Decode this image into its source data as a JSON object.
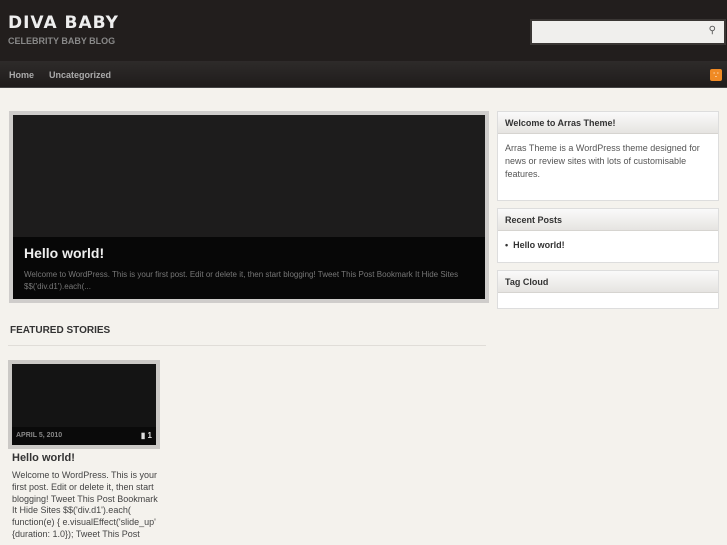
{
  "header": {
    "title": "DIVA BABY",
    "tagline": "CELEBRITY BABY BLOG",
    "search_placeholder": ""
  },
  "nav": {
    "items": [
      "Home",
      "Uncategorized"
    ]
  },
  "slideshow": {
    "title": "Hello world!",
    "excerpt": "Welcome to WordPress. This is your first post. Edit or delete it, then start blogging! Tweet This Post Bookmark It Hide Sites $$('div.d1').each(..."
  },
  "featured": {
    "heading": "FEATURED STORIES",
    "posts": [
      {
        "date": "APRIL 5, 2010",
        "comments": "1",
        "title": "Hello world!",
        "excerpt": "Welcome to WordPress. This is your first post. Edit or delete it, then start blogging! Tweet This Post Bookmark It Hide Sites $$('div.d1').each( function(e) { e.visualEffect('slide_up' {duration: 1.0}); Tweet This Post"
      }
    ]
  },
  "sidebar": {
    "widgets": [
      {
        "title": "Welcome to Arras Theme!",
        "body": "Arras Theme is a WordPress theme designed for news or review sites with lots of customisable features."
      },
      {
        "title": "Recent Posts",
        "items": [
          "Hello world!"
        ]
      },
      {
        "title": "Tag Cloud"
      }
    ]
  },
  "colors": {
    "header": "#221e1d",
    "background": "#f4f2ed",
    "rss": "#f08a24"
  }
}
